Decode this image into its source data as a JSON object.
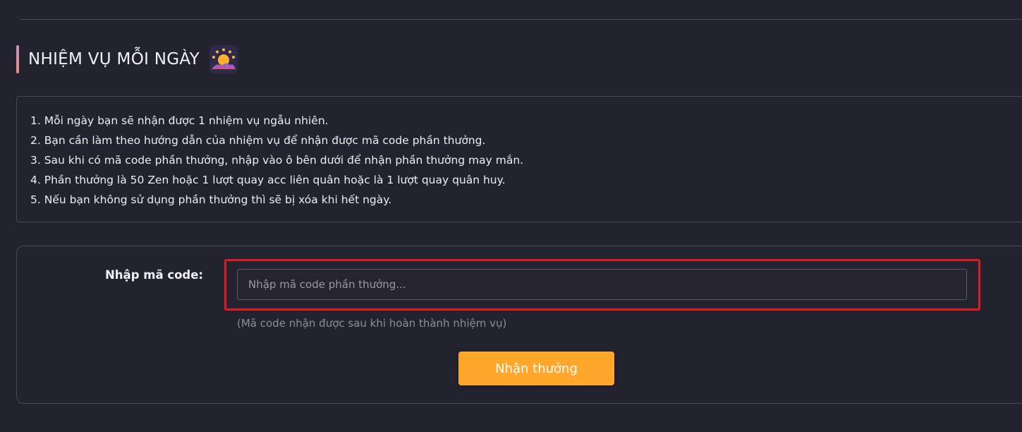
{
  "section": {
    "title": "NHIỆM VỤ MỖI NGÀY",
    "icon": "sunrise-over-mountains-icon",
    "accent_colors": [
      "#c58cc8",
      "#ef8c78"
    ]
  },
  "rules": [
    "1. Mỗi ngày bạn sẽ nhận được 1 nhiệm vụ ngẫu nhiên.",
    "2. Bạn cần làm theo hướng dẫn của nhiệm vụ để nhận được mã code phần thưởng.",
    "3. Sau khi có mã code phần thưởng, nhập vào ô bên dưới để nhận phần thưởng may mắn.",
    "4. Phần thưởng là 50 Zen hoặc 1 lượt quay acc liên quân hoặc là 1 lượt quay quân huy.",
    "5. Nếu bạn không sử dụng phần thưởng thì sẽ bị xóa khi hết ngày."
  ],
  "code_form": {
    "label": "Nhập mã code:",
    "input_value": "",
    "input_placeholder": "Nhập mã code phần thưởng...",
    "hint": "(Mã code nhận được sau khi hoàn thành nhiệm vụ)",
    "submit_label": "Nhận thưởng",
    "highlight_color": "#e01a22",
    "button_color": "#ffa62b"
  }
}
